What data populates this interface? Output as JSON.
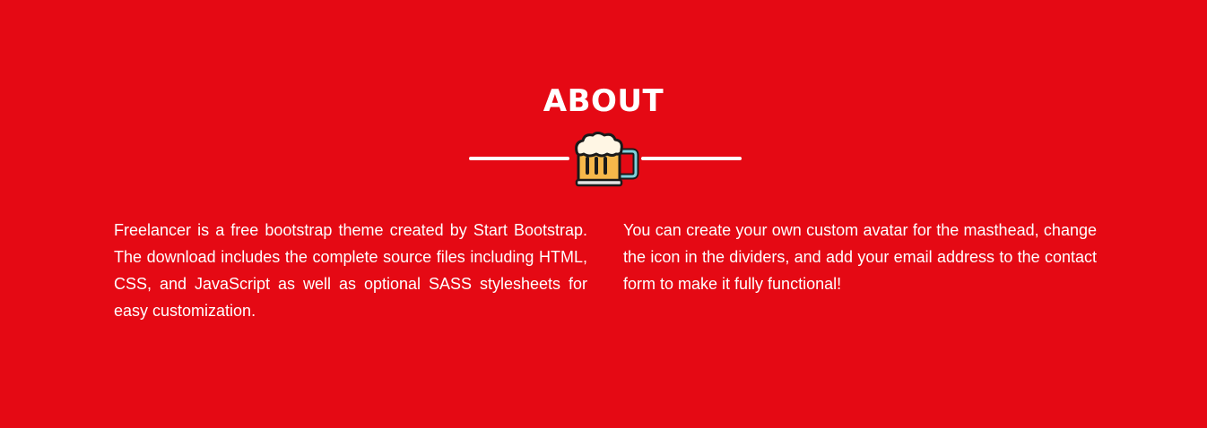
{
  "theme": {
    "background": "#e50914",
    "text": "#ffffff"
  },
  "about": {
    "title": "ABOUT",
    "divider_icon": "beer-mug-icon",
    "left_paragraph": "Freelancer is a free bootstrap theme created by Start Bootstrap. The download includes the complete source files including HTML, CSS, and JavaScript as well as optional SASS stylesheets for easy customization.",
    "right_paragraph": "You can create your own custom avatar for the masthead, change the icon in the dividers, and add your email address to the contact form to make it fully functional!"
  }
}
